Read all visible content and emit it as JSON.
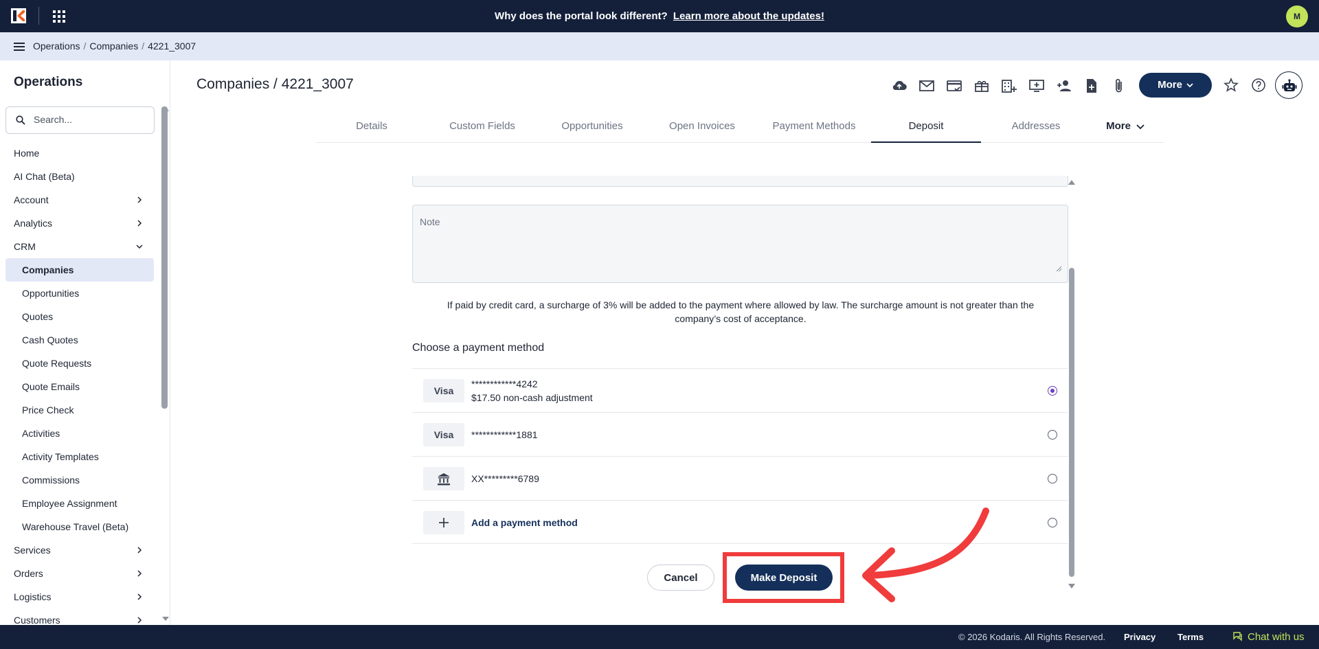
{
  "topbar": {
    "announcement": "Why does the portal look different?",
    "announcement_link": "Learn more about the updates!",
    "user_initial": "M"
  },
  "breadcrumb": [
    "Operations",
    "Companies",
    "4221_3007"
  ],
  "sidebar": {
    "title": "Operations",
    "search_placeholder": "Search...",
    "items": [
      {
        "label": "Home",
        "level": 0
      },
      {
        "label": "AI Chat (Beta)",
        "level": 0
      },
      {
        "label": "Account",
        "level": 0,
        "chevron": "right"
      },
      {
        "label": "Analytics",
        "level": 0,
        "chevron": "right"
      },
      {
        "label": "CRM",
        "level": 0,
        "chevron": "down"
      },
      {
        "label": "Companies",
        "level": 1,
        "active": true
      },
      {
        "label": "Opportunities",
        "level": 1
      },
      {
        "label": "Quotes",
        "level": 1
      },
      {
        "label": "Cash Quotes",
        "level": 1
      },
      {
        "label": "Quote Requests",
        "level": 1
      },
      {
        "label": "Quote Emails",
        "level": 1
      },
      {
        "label": "Price Check",
        "level": 1
      },
      {
        "label": "Activities",
        "level": 1
      },
      {
        "label": "Activity Templates",
        "level": 1
      },
      {
        "label": "Commissions",
        "level": 1
      },
      {
        "label": "Employee Assignment",
        "level": 1
      },
      {
        "label": "Warehouse Travel (Beta)",
        "level": 1
      },
      {
        "label": "Services",
        "level": 0,
        "chevron": "right"
      },
      {
        "label": "Orders",
        "level": 0,
        "chevron": "right"
      },
      {
        "label": "Logistics",
        "level": 0,
        "chevron": "right"
      },
      {
        "label": "Customers",
        "level": 0,
        "chevron": "right"
      }
    ]
  },
  "header": {
    "title": "Companies / 4221_3007",
    "more_label": "More",
    "action_icons": [
      "cloud-icon",
      "mail-icon",
      "card-check-icon",
      "gift-icon",
      "building-add-icon",
      "monitor-add-icon",
      "person-add-icon",
      "document-add-icon",
      "paperclip-icon"
    ]
  },
  "tabs": {
    "items": [
      "Details",
      "Custom Fields",
      "Opportunities",
      "Open Invoices",
      "Payment Methods",
      "Deposit",
      "Addresses"
    ],
    "active": "Deposit",
    "more_label": "More"
  },
  "form": {
    "note_placeholder": "Note",
    "surcharge_line1": "If paid by credit card, a surcharge of 3% will be added to the payment where allowed by law. The surcharge amount is not greater than the",
    "surcharge_line2": "company’s cost of acceptance.",
    "choose_label": "Choose a payment method",
    "payment_methods": [
      {
        "badge": "Visa",
        "number": "************4242",
        "detail": "$17.50 non-cash adjustment",
        "selected": true
      },
      {
        "badge": "Visa",
        "number": "************1881",
        "detail": "",
        "selected": false
      },
      {
        "badge": "bank-icon",
        "number": "XX*********6789",
        "detail": "",
        "selected": false
      },
      {
        "badge": "plus-icon",
        "number": "Add a payment method",
        "detail": "",
        "selected": false
      }
    ],
    "cancel_label": "Cancel",
    "submit_label": "Make Deposit"
  },
  "footer": {
    "copyright": "© 2026 Kodaris. All Rights Reserved.",
    "privacy": "Privacy",
    "terms": "Terms",
    "chat": "Chat with us"
  },
  "colors": {
    "navy": "#14203a",
    "button_navy": "#14305a",
    "accent_lime": "#c2e35a",
    "highlight_red": "#f03c3c",
    "radio_purple": "#6a3fc0"
  }
}
